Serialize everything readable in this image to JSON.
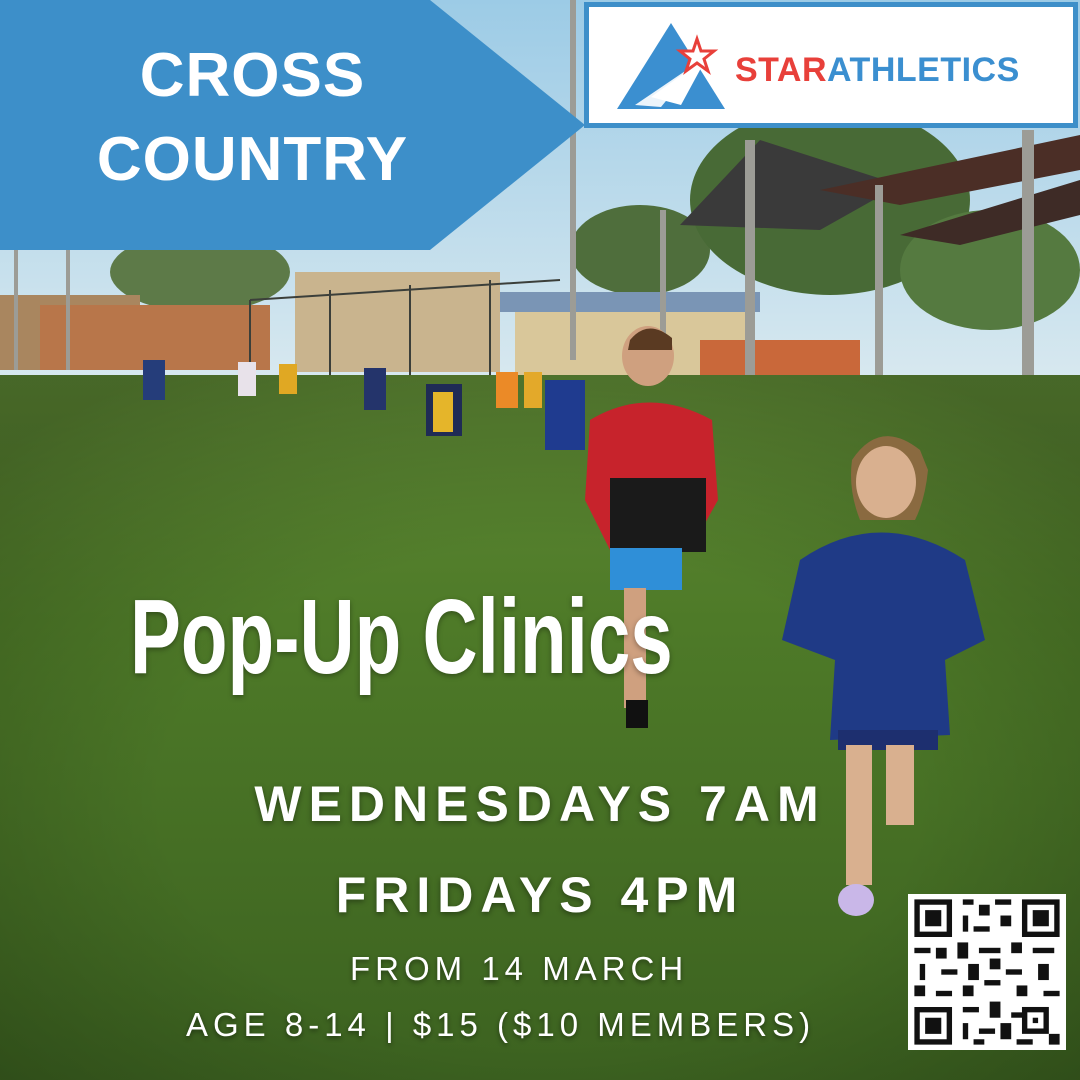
{
  "banner": {
    "line1": "CROSS",
    "line2": "COUNTRY",
    "color": "#3d8fc9"
  },
  "logo": {
    "word_star": "STAR",
    "word_athletics": "ATHLETICS",
    "red": "#e8403a",
    "blue": "#3b8fd0"
  },
  "headline": "Pop-Up Clinics",
  "schedule": {
    "line1": "WEDNESDAYS 7AM",
    "line2": "FRIDAYS 4PM"
  },
  "details": {
    "start": "FROM 14 MARCH",
    "price": "AGE 8-14 | $15 ($10 MEMBERS)"
  },
  "qr_icon": "qr-code-icon"
}
